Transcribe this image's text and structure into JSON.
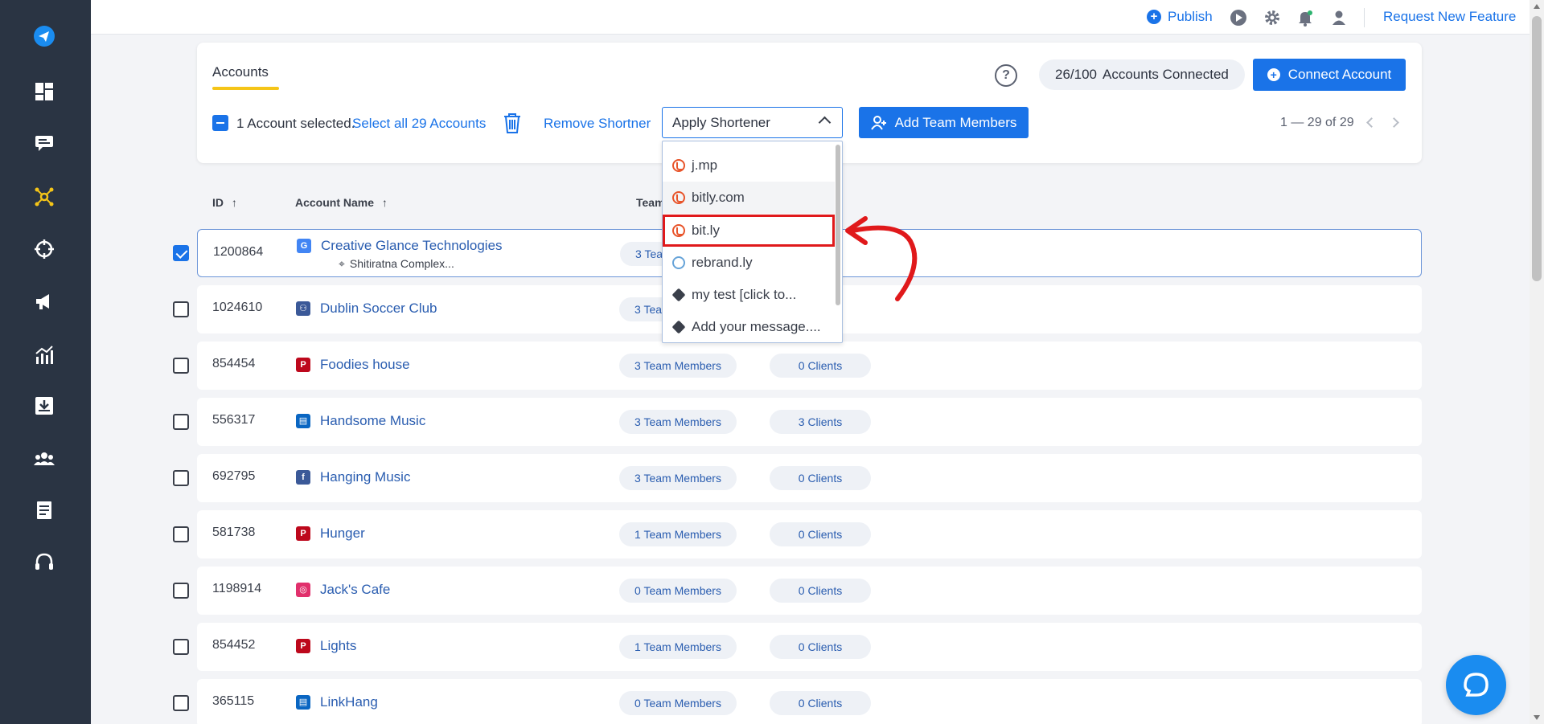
{
  "sidebar": {
    "items": [
      {
        "icon": "paper-plane-icon"
      },
      {
        "icon": "dashboard-icon"
      },
      {
        "icon": "chat-icon"
      },
      {
        "icon": "network-icon",
        "active": true
      },
      {
        "icon": "crosshair-icon"
      },
      {
        "icon": "megaphone-icon"
      },
      {
        "icon": "analytics-icon"
      },
      {
        "icon": "download-icon"
      },
      {
        "icon": "team-icon"
      },
      {
        "icon": "document-icon"
      },
      {
        "icon": "headset-icon"
      }
    ],
    "active_color": "#f5c518"
  },
  "topbar": {
    "publish_label": "Publish",
    "request_feature_label": "Request New Feature",
    "icons": [
      "play-icon",
      "gear-icon",
      "notification-bell-icon",
      "user-icon"
    ]
  },
  "header": {
    "tab_label": "Accounts",
    "accounts_connected_count": "26/100",
    "accounts_connected_label": "Accounts Connected",
    "connect_account_label": "Connect Account",
    "selected_text": "1 Account selected.",
    "select_all_label": "Select all 29 Accounts",
    "remove_shortner_label": "Remove Shortner",
    "apply_shortener_label": "Apply Shortener",
    "add_team_members_label": "Add Team Members",
    "pagination_text": "1 — 29 of 29"
  },
  "table": {
    "columns": {
      "id": "ID",
      "account_name": "Account Name",
      "team": "Team"
    },
    "sort_indicator": "↑",
    "rows": [
      {
        "id": "1200864",
        "name": "Creative Glance Technologies",
        "sub": "Shitiratna Complex...",
        "team": "3 Team Members",
        "clients": "",
        "icon": "google-business-icon",
        "color": "#4285f4",
        "checked": true
      },
      {
        "id": "1024610",
        "name": "Dublin Soccer Club",
        "sub": "",
        "team": "3 Team Members",
        "clients": "",
        "icon": "facebook-group-icon",
        "color": "#3b5998",
        "checked": false
      },
      {
        "id": "854454",
        "name": "Foodies house",
        "sub": "",
        "team": "3 Team Members",
        "clients": "0 Clients",
        "icon": "pinterest-icon",
        "color": "#bd081c",
        "checked": false
      },
      {
        "id": "556317",
        "name": "Handsome Music",
        "sub": "",
        "team": "3 Team Members",
        "clients": "3 Clients",
        "icon": "linkedin-page-icon",
        "color": "#0a66c2",
        "checked": false
      },
      {
        "id": "692795",
        "name": "Hanging Music",
        "sub": "",
        "team": "3 Team Members",
        "clients": "0 Clients",
        "icon": "facebook-icon",
        "color": "#3b5998",
        "checked": false
      },
      {
        "id": "581738",
        "name": "Hunger",
        "sub": "",
        "team": "1 Team Members",
        "clients": "0 Clients",
        "icon": "pinterest-icon",
        "color": "#bd081c",
        "checked": false
      },
      {
        "id": "1198914",
        "name": "Jack's Cafe",
        "sub": "",
        "team": "0 Team Members",
        "clients": "0 Clients",
        "icon": "instagram-icon",
        "color": "#e1306c",
        "checked": false
      },
      {
        "id": "854452",
        "name": "Lights",
        "sub": "",
        "team": "1 Team Members",
        "clients": "0 Clients",
        "icon": "pinterest-icon",
        "color": "#bd081c",
        "checked": false
      },
      {
        "id": "365115",
        "name": "LinkHang",
        "sub": "",
        "team": "0 Team Members",
        "clients": "0 Clients",
        "icon": "linkedin-page-icon",
        "color": "#0a66c2",
        "checked": false
      }
    ]
  },
  "dropdown": {
    "options": [
      {
        "label": "j.mp",
        "icon": "bitly-icon"
      },
      {
        "label": "bitly.com",
        "icon": "bitly-icon"
      },
      {
        "label": "bit.ly",
        "icon": "bitly-icon"
      },
      {
        "label": "rebrand.ly",
        "icon": "rebrandly-icon"
      },
      {
        "label": "my test [click to...",
        "icon": "tag-icon"
      },
      {
        "label": "Add your message....",
        "icon": "tag-icon"
      }
    ],
    "highlighted": "bit.ly",
    "highlight_color": "#e0191b"
  },
  "colors": {
    "accent": "#1a73e8",
    "sidebar_bg": "#2a3443"
  }
}
